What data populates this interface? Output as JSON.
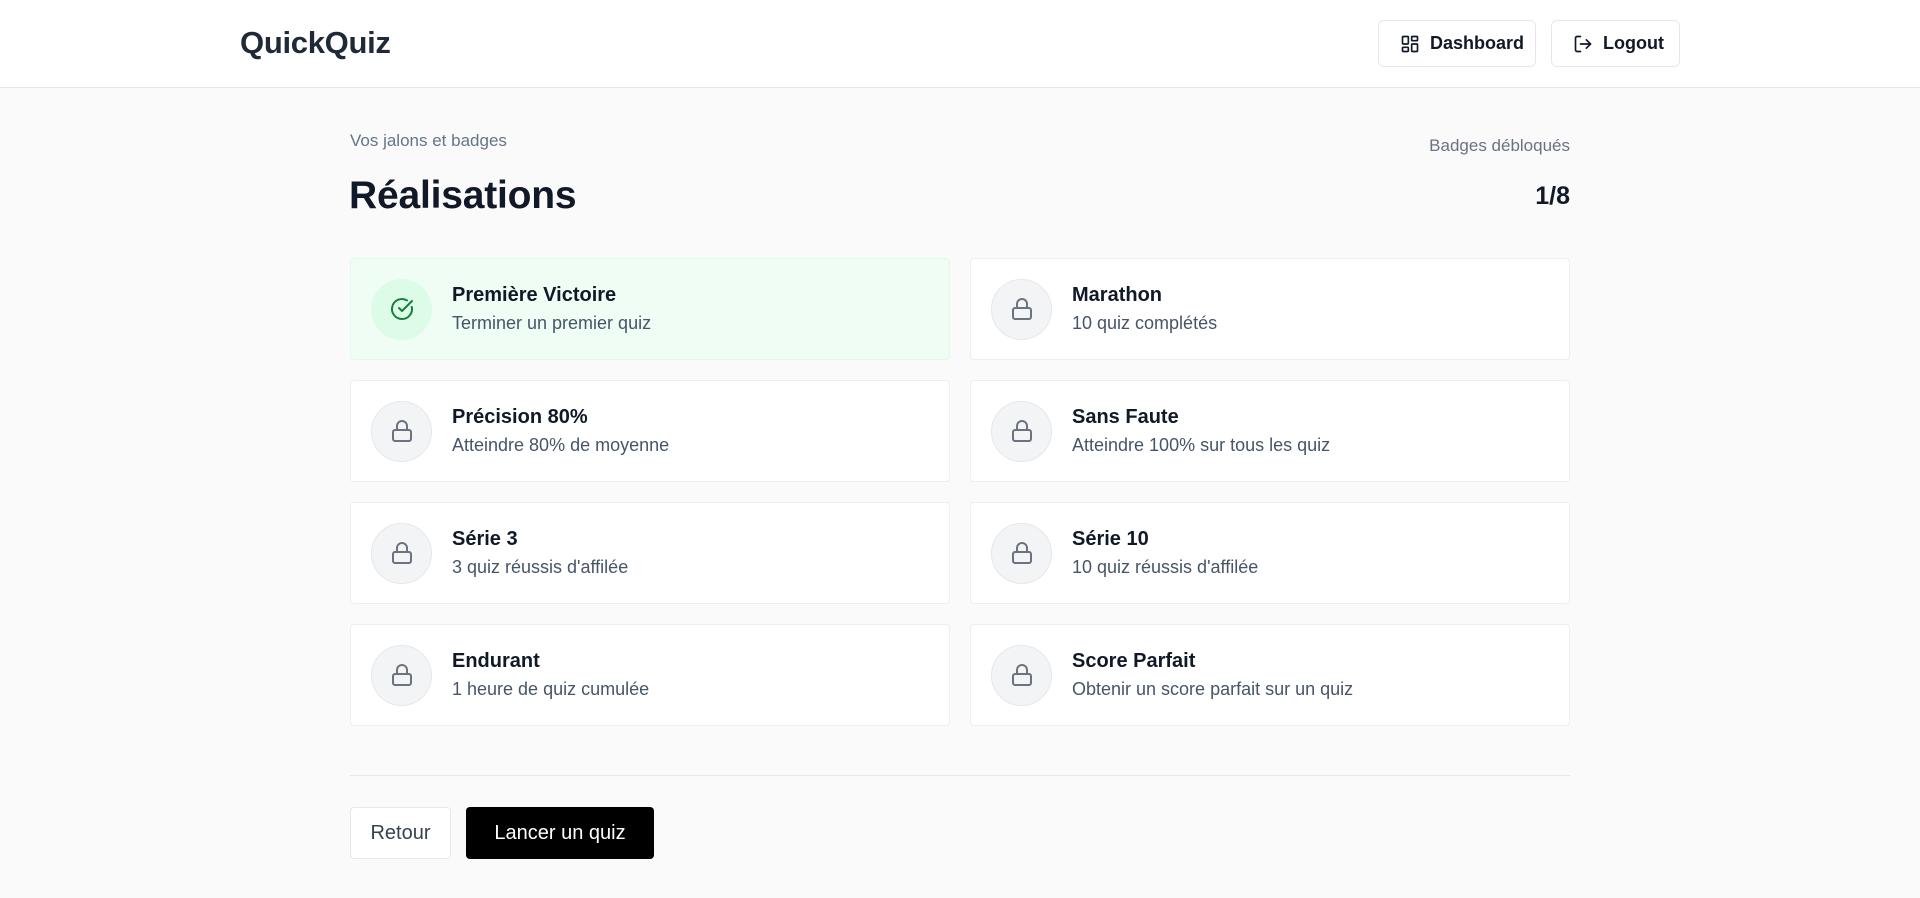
{
  "app": {
    "brand": "QuickQuiz"
  },
  "header": {
    "dashboard_label": "Dashboard",
    "logout_label": "Logout"
  },
  "page": {
    "eyebrow": "Vos jalons et badges",
    "title": "Réalisations",
    "stat_label": "Badges débloqués",
    "stat_value": "1/8"
  },
  "badges": [
    {
      "title": "Première Victoire",
      "description": "Terminer un premier quiz",
      "unlocked": true,
      "icon": "check-circle-icon"
    },
    {
      "title": "Marathon",
      "description": "10 quiz complétés",
      "unlocked": false,
      "icon": "lock-icon"
    },
    {
      "title": "Précision 80%",
      "description": "Atteindre 80% de moyenne",
      "unlocked": false,
      "icon": "lock-icon"
    },
    {
      "title": "Sans Faute",
      "description": "Atteindre 100% sur tous les quiz",
      "unlocked": false,
      "icon": "lock-icon"
    },
    {
      "title": "Série 3",
      "description": "3 quiz réussis d'affilée",
      "unlocked": false,
      "icon": "lock-icon"
    },
    {
      "title": "Série 10",
      "description": "10 quiz réussis d'affilée",
      "unlocked": false,
      "icon": "lock-icon"
    },
    {
      "title": "Endurant",
      "description": "1 heure de quiz cumulée",
      "unlocked": false,
      "icon": "lock-icon"
    },
    {
      "title": "Score Parfait",
      "description": "Obtenir un score parfait sur un quiz",
      "unlocked": false,
      "icon": "lock-icon"
    }
  ],
  "actions": {
    "back_label": "Retour",
    "start_label": "Lancer un quiz"
  },
  "colors": {
    "unlocked_bg": "#f0fdf4",
    "unlocked_icon": "#15803d",
    "locked_icon": "#6b7280",
    "primary": "#000000"
  }
}
